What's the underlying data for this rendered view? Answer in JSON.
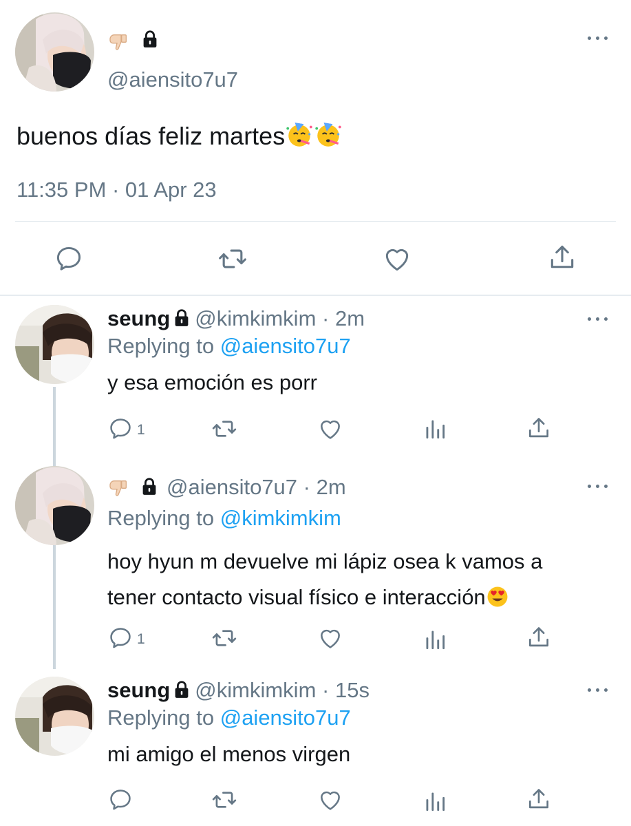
{
  "main_tweet": {
    "author_handle": "@aiensito7u7",
    "author_name_icons": [
      "thumbs-down-icon",
      "lock-icon"
    ],
    "text": "buenos días feliz martes",
    "emoji": [
      "partying-face-emoji",
      "partying-face-emoji"
    ],
    "timestamp": "11:35 PM · 01 Apr 23",
    "actions": [
      "reply",
      "retweet",
      "like",
      "share"
    ]
  },
  "replies": [
    {
      "name": "seung",
      "handle": "@kimkimkim",
      "sep": "·",
      "time": "2m",
      "replying_prefix": "Replying to",
      "replying_handle": "@aiensito7u7",
      "text": "y esa emoción es porr",
      "reply_count": "1"
    },
    {
      "name_icons": [
        "thumbs-down-icon",
        "lock-icon"
      ],
      "handle": "@aiensito7u7",
      "sep": "·",
      "time": "2m",
      "replying_prefix": "Replying to",
      "replying_handle": "@kimkimkim",
      "text_line1": "hoy hyun m devuelve mi lápiz osea k vamos a",
      "text_line2": "tener contacto visual físico e interacción",
      "emoji": "heart-eyes-emoji",
      "reply_count": "1"
    },
    {
      "name": "seung",
      "handle": "@kimkimkim",
      "sep": "·",
      "time": "15s",
      "replying_prefix": "Replying to",
      "replying_handle": "@aiensito7u7",
      "text": "mi amigo el menos virgen",
      "reply_count": ""
    }
  ],
  "colors": {
    "text": "#14171a",
    "secondary": "#657786",
    "link": "#1da1f2",
    "divider": "#e1e8ed"
  }
}
